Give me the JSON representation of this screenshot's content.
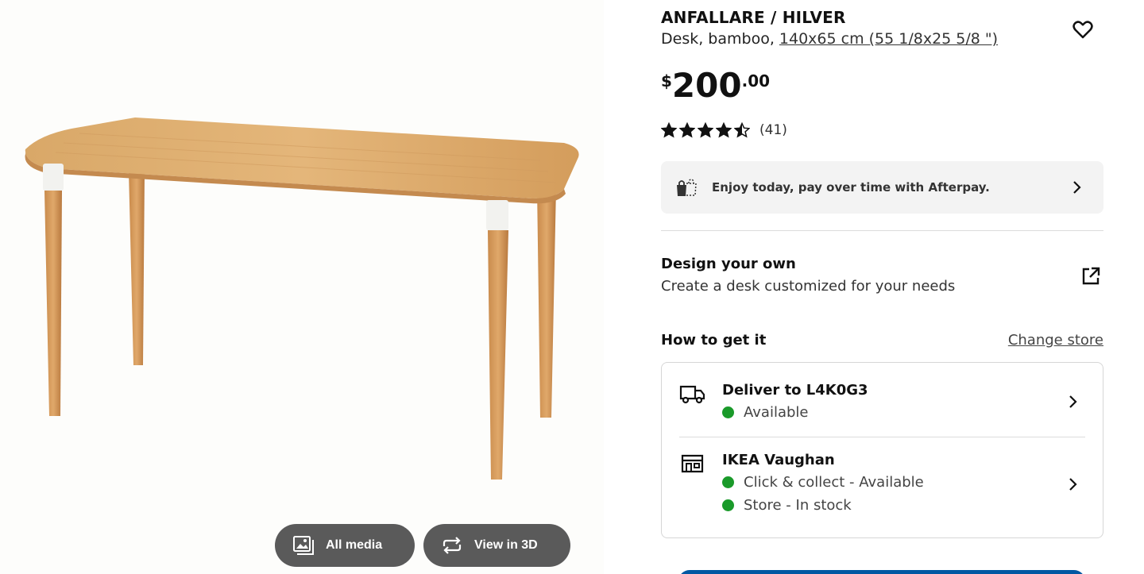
{
  "media": {
    "all_media_label": "All media",
    "view3d_label": "View in 3D"
  },
  "product": {
    "name": "ANFALLARE / HILVER",
    "description": "Desk, bamboo, ",
    "dimensions": "140x65 cm (55 1/8x25 5/8 \")",
    "price": {
      "currency": "$",
      "integer": "200",
      "decimal": ".00"
    },
    "rating": {
      "stars": 4.5,
      "max": 5,
      "count": "(41)"
    }
  },
  "afterpay": {
    "text": "Enjoy today, pay over time with Afterpay."
  },
  "design": {
    "title": "Design your own",
    "subtitle": "Create a desk customized for your needs"
  },
  "availability": {
    "heading": "How to get it",
    "change_store": "Change store",
    "delivery": {
      "title": "Deliver to L4K0G3",
      "status": "Available"
    },
    "store": {
      "title": "IKEA Vaughan",
      "status1": "Click & collect - Available",
      "status2": "Store - In stock"
    }
  },
  "colors": {
    "available": "#1a9a2a",
    "media_button": "#5a5a5a",
    "afterpay_bg": "#f3f3f3"
  },
  "icons": [
    "image-gallery-icon",
    "rotate-3d-icon",
    "heart-icon",
    "star-icon",
    "shopping-bag-icon",
    "chevron-right-icon",
    "external-link-icon",
    "truck-icon",
    "store-icon"
  ]
}
